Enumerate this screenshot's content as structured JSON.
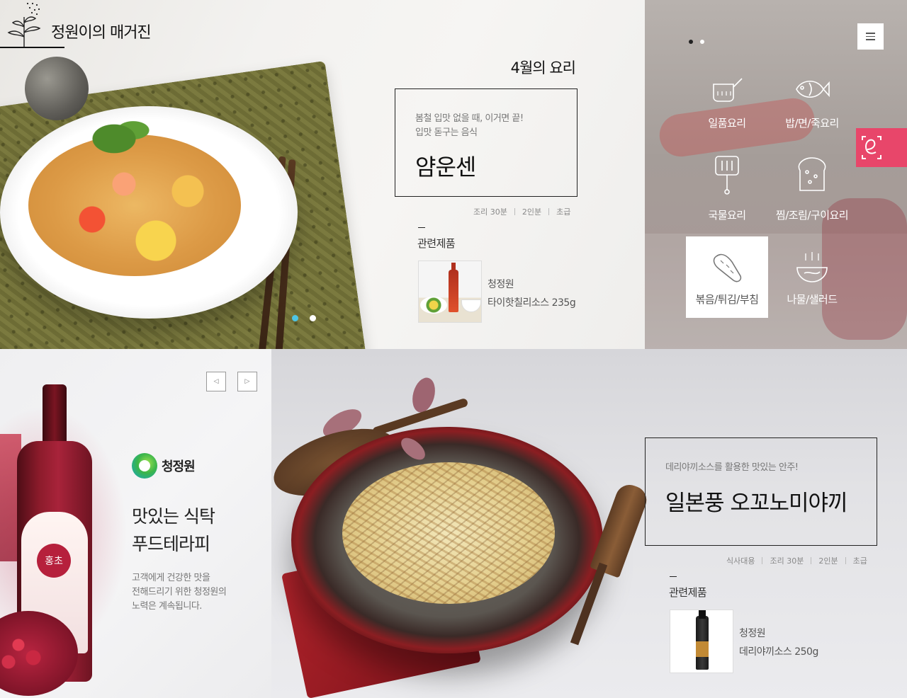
{
  "header": {
    "logo_text": "정원이의 매거진"
  },
  "hero": {
    "month_title": "4월의 요리",
    "recipe": {
      "subtitle_line1": "봄철 입맛 없을 때, 이거면 끝!",
      "subtitle_line2": "입맛 돋구는 음식",
      "name": "얌운센"
    },
    "meta": [
      "조리 30분",
      "2인분",
      "초급"
    ],
    "related_title": "관련제품",
    "product": {
      "brand": "청정원",
      "name": "타이핫칠리소스 235g"
    },
    "slide_index": 1,
    "slide_count": 2
  },
  "categories": {
    "slide_index": 2,
    "slide_count": 2,
    "menu_icon": "hamburger-icon",
    "items": [
      {
        "label": "일품요리",
        "icon": "pot-icon"
      },
      {
        "label": "밥/면/죽요리",
        "icon": "fish-icon"
      },
      {
        "label": "국물요리",
        "icon": "pot-handle-icon"
      },
      {
        "label": "찜/조림/구이요리",
        "icon": "bread-icon"
      },
      {
        "label": "볶음/튀김/부침",
        "icon": "vegetable-icon"
      },
      {
        "label": "나물/샐러드",
        "icon": "salad-bowl-icon"
      }
    ],
    "active_index": 4,
    "badge_icon": "e-letter-icon",
    "badge_color": "#e8466a"
  },
  "promo": {
    "brand": "청정원",
    "title_line1": "맛있는 식탁",
    "title_line2": "푸드테라피",
    "desc_line1": "고객에게 건강한 맛을",
    "desc_line2": "전해드리기 위한 청정원의",
    "desc_line3": "노력은 계속됩니다.",
    "bottle_badge": "홍초",
    "prev_icon": "triangle-left-icon",
    "next_icon": "triangle-right-icon",
    "prev_glyph": "◁",
    "next_glyph": "▷"
  },
  "feature": {
    "recipe": {
      "subtitle": "데리야끼소스를 활용한 맛있는 안주!",
      "name": "일본풍 오꼬노미야끼"
    },
    "meta": [
      "식사대용",
      "조리 30분",
      "2인분",
      "초급"
    ],
    "related_title": "관련제품",
    "product": {
      "brand": "청정원",
      "name": "데리야끼소스 250g"
    }
  },
  "colors": {
    "accent_pink": "#e8466a",
    "active_dot": "#4dc5e6"
  }
}
